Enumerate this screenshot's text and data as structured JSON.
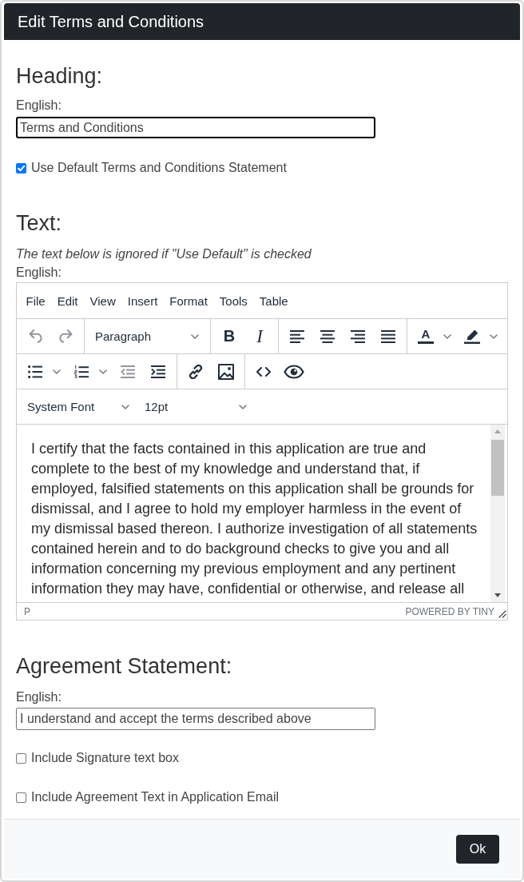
{
  "dialog": {
    "title": "Edit Terms and Conditions"
  },
  "heading_section": {
    "heading": "Heading:",
    "field_label": "English:",
    "value": "Terms and Conditions",
    "focused": true,
    "checkbox": {
      "label": "Use Default Terms and Conditions Statement",
      "checked": true
    }
  },
  "text_section": {
    "heading": "Text:",
    "note": "The text below is ignored if \"Use Default\" is checked",
    "field_label": "English:",
    "editor": {
      "menu": [
        "File",
        "Edit",
        "View",
        "Insert",
        "Format",
        "Tools",
        "Table"
      ],
      "toolbar_rows": [
        [
          {
            "items": [
              {
                "kind": "undo",
                "disabled": true
              },
              {
                "kind": "redo",
                "disabled": true
              }
            ]
          },
          {
            "items": [
              {
                "kind": "select",
                "value": "Paragraph"
              }
            ]
          },
          {
            "items": [
              {
                "kind": "bold",
                "glyph": "B",
                "disabled": false
              },
              {
                "kind": "italic",
                "glyph": "I",
                "disabled": false
              }
            ]
          },
          {
            "items": [
              {
                "kind": "alignleft",
                "disabled": false
              },
              {
                "kind": "aligncenter",
                "disabled": false
              },
              {
                "kind": "alignright",
                "disabled": false
              },
              {
                "kind": "alignjustify",
                "disabled": false
              }
            ]
          },
          {
            "items": [
              {
                "kind": "textcolor",
                "glyph": "A",
                "split": true,
                "disabled": false
              },
              {
                "kind": "highlight",
                "split": true,
                "disabled": false
              }
            ]
          }
        ],
        [
          {
            "items": [
              {
                "kind": "bullist",
                "split": true,
                "disabled": false
              },
              {
                "kind": "numlist",
                "split": true,
                "disabled": false
              },
              {
                "kind": "outdent",
                "disabled": true
              },
              {
                "kind": "indent",
                "disabled": false
              }
            ]
          },
          {
            "items": [
              {
                "kind": "link",
                "disabled": false
              },
              {
                "kind": "image",
                "disabled": false
              }
            ]
          },
          {
            "items": [
              {
                "kind": "code",
                "disabled": false
              },
              {
                "kind": "preview",
                "disabled": false
              }
            ]
          }
        ],
        [
          {
            "items": [
              {
                "kind": "select",
                "value": "System Font"
              },
              {
                "kind": "select",
                "value": "12pt"
              }
            ]
          }
        ]
      ],
      "content": "I certify that the facts contained in this application are true and complete to the best of my knowledge and understand that, if employed, falsified statements on this application shall be grounds for dismissal, and I agree to hold my employer harmless in the event of my dismissal based thereon. I authorize investigation of all statements contained herein and to do background checks to give you and all information concerning my previous employment and any pertinent information they may have, confidential or otherwise, and release all",
      "path": "P",
      "branding": "POWERED BY TINY"
    }
  },
  "agreement_section": {
    "heading": "Agreement Statement:",
    "field_label": "English:",
    "value": "I understand and accept the terms described above",
    "focused": false,
    "checkboxes": [
      {
        "label": "Include Signature text box",
        "checked": false
      },
      {
        "label": "Include Agreement Text in Application Email",
        "checked": false
      }
    ]
  },
  "footer": {
    "buttons": [
      {
        "label": "Ok"
      }
    ]
  }
}
